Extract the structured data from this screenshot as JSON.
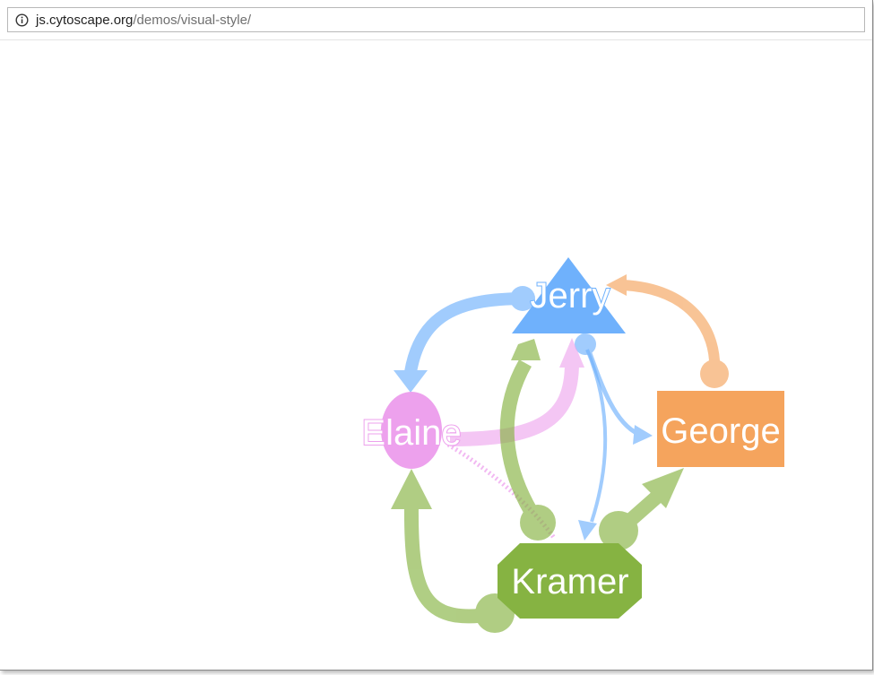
{
  "browser": {
    "url_host": "js.cytoscape.org",
    "url_path": "/demos/visual-style/",
    "address_icon": "info-icon"
  },
  "graph": {
    "nodes": [
      {
        "id": "jerry",
        "label": "Jerry",
        "shape": "triangle",
        "color": "#6fb1fc"
      },
      {
        "id": "elaine",
        "label": "Elaine",
        "shape": "ellipse",
        "color": "#eda1ed"
      },
      {
        "id": "george",
        "label": "George",
        "shape": "rectangle",
        "color": "#f5a45d"
      },
      {
        "id": "kramer",
        "label": "Kramer",
        "shape": "octagon",
        "color": "#86b342"
      }
    ],
    "edge_colors": {
      "jerry": "#6fb1fc",
      "elaine": "#eda1ed",
      "george": "#f5a45d",
      "kramer": "#86b342"
    }
  }
}
